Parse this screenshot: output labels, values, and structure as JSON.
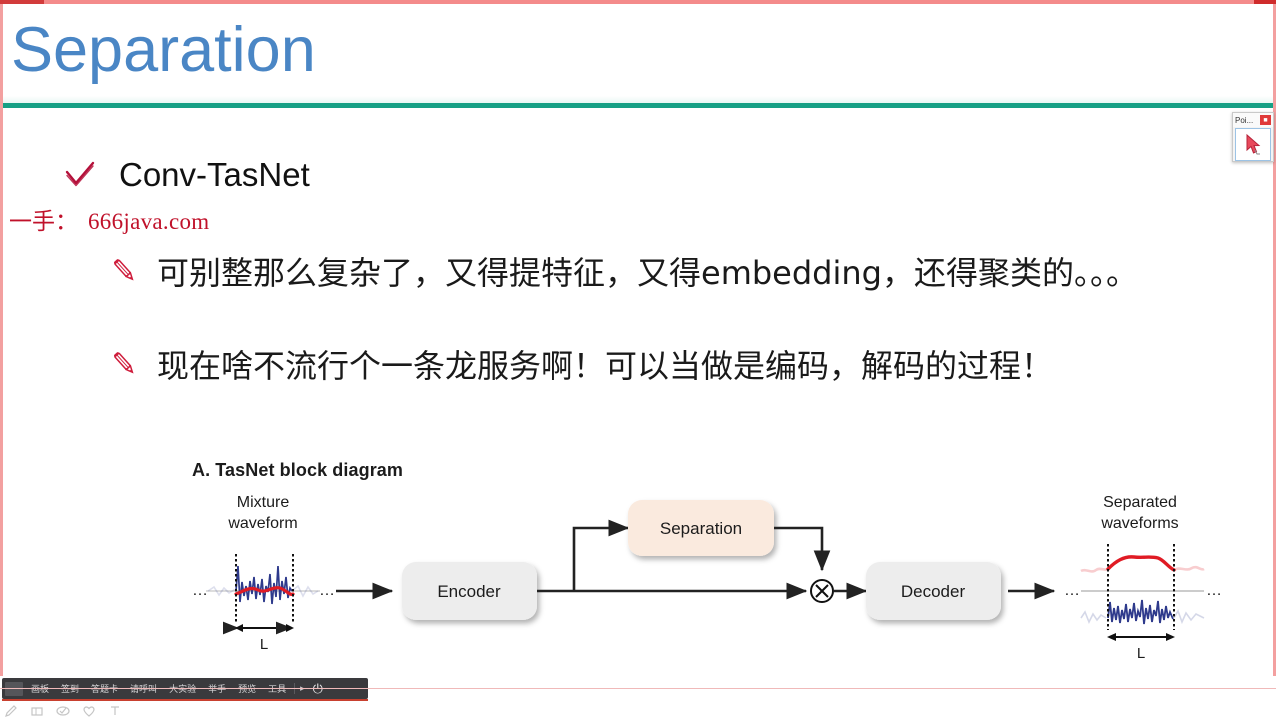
{
  "slide": {
    "title": "Separation",
    "title_color": "#4a86c5",
    "rule_color": "#16a085",
    "bullet_check": {
      "icon": "check-icon",
      "label": "Conv-TasNet"
    },
    "watermark": {
      "prefix": "一手：",
      "url": "666java.com",
      "color": "#c0112a"
    },
    "notes": [
      {
        "icon": "pencil-icon",
        "text": "可别整那么复杂了，又得提特征，又得embedding，还得聚类的。。。"
      },
      {
        "icon": "pencil-icon",
        "text": "现在啥不流行个一条龙服务啊！可以当做是编码，解码的过程！"
      }
    ]
  },
  "figure": {
    "caption": "A. TasNet block diagram",
    "input_label_line1": "Mixture",
    "input_label_line2": "waveform",
    "output_label_line1": "Separated",
    "output_label_line2": "waveforms",
    "length_marker": "L",
    "ellipsis": "…",
    "blocks": [
      {
        "name": "encoder",
        "label": "Encoder",
        "fill": "#ededed"
      },
      {
        "name": "separation",
        "label": "Separation",
        "fill": "#faeade"
      },
      {
        "name": "decoder",
        "label": "Decoder",
        "fill": "#ededed"
      }
    ],
    "multiply_node": "⊗",
    "waveform_colors": {
      "mixture_primary": "#2e3a8c",
      "mixture_overlay": "#e01b24",
      "separated_top": "#e01b24",
      "separated_bottom": "#2e3a8c"
    }
  },
  "float_widget": {
    "title": "Poi...",
    "close_label": "■"
  },
  "toolbar": {
    "items": [
      {
        "name": "whiteboard",
        "label": "画板"
      },
      {
        "name": "signin",
        "label": "签到"
      },
      {
        "name": "answer-card",
        "label": "答题卡"
      },
      {
        "name": "invite",
        "label": "请呼叫"
      },
      {
        "name": "big-class",
        "label": "大实验"
      },
      {
        "name": "raise-hand",
        "label": "举手"
      },
      {
        "name": "preview",
        "label": "预览"
      },
      {
        "name": "tools",
        "label": "工具"
      }
    ],
    "collapse_label": "▸",
    "power_label": "⏻"
  }
}
